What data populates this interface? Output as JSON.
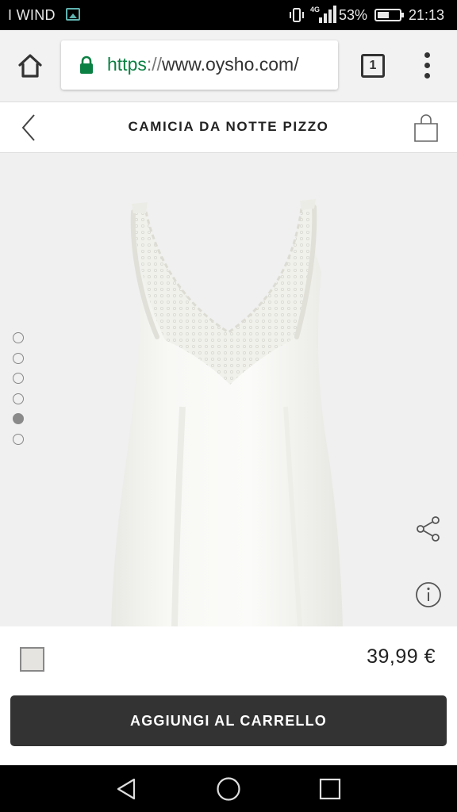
{
  "status_bar": {
    "carrier": "I WIND",
    "network": "4G",
    "battery_percent": "53%",
    "battery_level": 0.53,
    "time": "21:13"
  },
  "browser": {
    "url_scheme": "https",
    "url_separator": "://",
    "url_host": "www.oysho.com/",
    "tab_count": "1",
    "icons": [
      "home-icon",
      "lock-icon",
      "tabs-icon",
      "overflow-menu-icon"
    ],
    "accent_color": "#0b8043"
  },
  "product": {
    "title": "CAMICIA DA NOTTE PIZZO",
    "price": "39,99 €",
    "swatch_color": "#e6e4e0",
    "image_count": 6,
    "active_image_index": 4,
    "add_to_cart_label": "AGGIUNGI AL CARRELLO",
    "button_color": "#333333"
  },
  "nav_bar": {
    "icons": [
      "back-triangle-icon",
      "home-circle-icon",
      "recents-square-icon"
    ]
  }
}
